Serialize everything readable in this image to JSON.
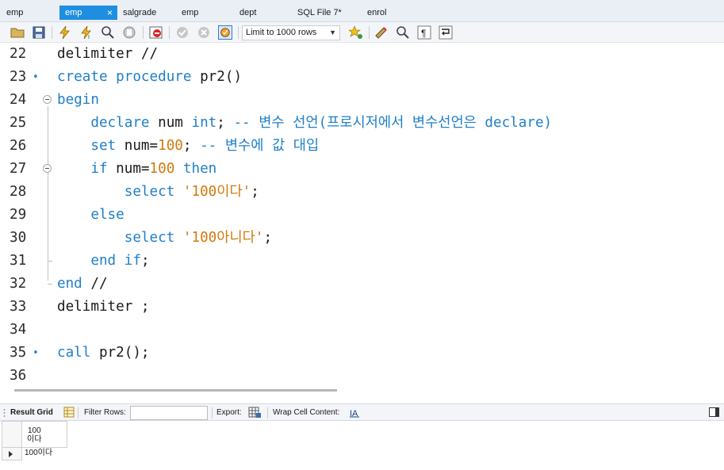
{
  "tabs": [
    {
      "label": "emp",
      "active": false
    },
    {
      "label": "emp",
      "active": true
    },
    {
      "label": "salgrade",
      "active": false
    },
    {
      "label": "emp",
      "active": false
    },
    {
      "label": "dept",
      "active": false
    },
    {
      "label": "SQL File 7*",
      "active": false
    },
    {
      "label": "enrol",
      "active": false
    }
  ],
  "tab_close": "×",
  "toolbar": {
    "limit_label": "Limit to 1000 rows",
    "icons": [
      "open-folder-icon",
      "save-icon",
      "execute-icon",
      "execute-current-icon",
      "explain-icon",
      "stop-icon",
      "stop-on-error-icon",
      "commit-icon",
      "rollback-icon",
      "autocommit-icon",
      "bookmark-icon",
      "beautify-icon",
      "find-icon",
      "invisible-chars-icon",
      "wrap-icon"
    ]
  },
  "editor": {
    "lines": [
      {
        "n": "22",
        "marker": "",
        "tokens": [
          {
            "t": "delimiter //",
            "c": "pl"
          }
        ]
      },
      {
        "n": "23",
        "marker": "•",
        "tokens": [
          {
            "t": "create procedure",
            "c": "kw"
          },
          {
            "t": " pr2()",
            "c": "pl"
          }
        ]
      },
      {
        "n": "24",
        "marker": "",
        "tokens": [
          {
            "t": "begin",
            "c": "kw"
          }
        ]
      },
      {
        "n": "25",
        "marker": "",
        "tokens": [
          {
            "t": "    ",
            "c": "pl"
          },
          {
            "t": "declare",
            "c": "kw"
          },
          {
            "t": " num ",
            "c": "pl"
          },
          {
            "t": "int",
            "c": "kw"
          },
          {
            "t": "; ",
            "c": "pl"
          },
          {
            "t": "-- 변수 선언(프로시저에서 변수선언은 declare)",
            "c": "cm"
          }
        ]
      },
      {
        "n": "26",
        "marker": "",
        "tokens": [
          {
            "t": "    ",
            "c": "pl"
          },
          {
            "t": "set",
            "c": "kw"
          },
          {
            "t": " num=",
            "c": "pl"
          },
          {
            "t": "100",
            "c": "num"
          },
          {
            "t": "; ",
            "c": "pl"
          },
          {
            "t": "-- 변수에 값 대입",
            "c": "cm"
          }
        ]
      },
      {
        "n": "27",
        "marker": "",
        "tokens": [
          {
            "t": "    ",
            "c": "pl"
          },
          {
            "t": "if",
            "c": "kw"
          },
          {
            "t": " num=",
            "c": "pl"
          },
          {
            "t": "100",
            "c": "num"
          },
          {
            "t": " ",
            "c": "pl"
          },
          {
            "t": "then",
            "c": "kw"
          }
        ]
      },
      {
        "n": "28",
        "marker": "",
        "tokens": [
          {
            "t": "        ",
            "c": "pl"
          },
          {
            "t": "select",
            "c": "kw"
          },
          {
            "t": " ",
            "c": "pl"
          },
          {
            "t": "'100이다'",
            "c": "str"
          },
          {
            "t": ";",
            "c": "pl"
          }
        ]
      },
      {
        "n": "29",
        "marker": "",
        "tokens": [
          {
            "t": "    ",
            "c": "pl"
          },
          {
            "t": "else",
            "c": "kw"
          }
        ]
      },
      {
        "n": "30",
        "marker": "",
        "tokens": [
          {
            "t": "        ",
            "c": "pl"
          },
          {
            "t": "select",
            "c": "kw"
          },
          {
            "t": " ",
            "c": "pl"
          },
          {
            "t": "'100아니다'",
            "c": "str"
          },
          {
            "t": ";",
            "c": "pl"
          }
        ]
      },
      {
        "n": "31",
        "marker": "",
        "tokens": [
          {
            "t": "    ",
            "c": "pl"
          },
          {
            "t": "end if",
            "c": "kw"
          },
          {
            "t": ";",
            "c": "pl"
          }
        ]
      },
      {
        "n": "32",
        "marker": "",
        "tokens": [
          {
            "t": "end",
            "c": "kw"
          },
          {
            "t": " //",
            "c": "pl"
          }
        ]
      },
      {
        "n": "33",
        "marker": "",
        "tokens": [
          {
            "t": "delimiter ;",
            "c": "pl"
          }
        ]
      },
      {
        "n": "34",
        "marker": "",
        "tokens": []
      },
      {
        "n": "35",
        "marker": "•",
        "tokens": [
          {
            "t": "call",
            "c": "kw"
          },
          {
            "t": " pr2();",
            "c": "pl"
          }
        ]
      },
      {
        "n": "36",
        "marker": "",
        "tokens": []
      }
    ]
  },
  "resultbar": {
    "result_grid": "Result Grid",
    "filter_rows": "Filter Rows:",
    "filter_value": "",
    "export": "Export:",
    "wrap": "Wrap Cell Content:"
  },
  "grid": {
    "column_header_line1": "100",
    "column_header_line2": "이다",
    "cell_value": "100이다"
  },
  "colors": {
    "keyword": "#1f7fc9",
    "number": "#d0790d",
    "active_tab": "#1e8ee0"
  }
}
